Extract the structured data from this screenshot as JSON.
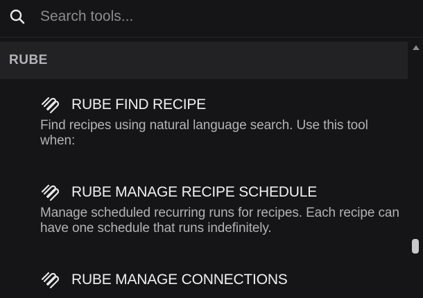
{
  "search": {
    "placeholder": "Search tools...",
    "value": ""
  },
  "group": {
    "label": "RUBE"
  },
  "tools": [
    {
      "title": "RUBE FIND RECIPE",
      "description": "Find recipes using natural language search. Use this tool when:",
      "icon": "composio-swirl-icon"
    },
    {
      "title": "RUBE MANAGE RECIPE SCHEDULE",
      "description": "Manage scheduled recurring runs for recipes. Each recipe can have one schedule that runs indefinitely.",
      "icon": "composio-swirl-icon"
    },
    {
      "title": "RUBE MANAGE CONNECTIONS",
      "description": "",
      "icon": "composio-swirl-icon"
    }
  ],
  "colors": {
    "background": "#151517",
    "group_header_bg": "#222225",
    "text_primary": "#f0f0f0",
    "text_secondary": "#b3b3b6",
    "placeholder": "#8c8c8f"
  }
}
